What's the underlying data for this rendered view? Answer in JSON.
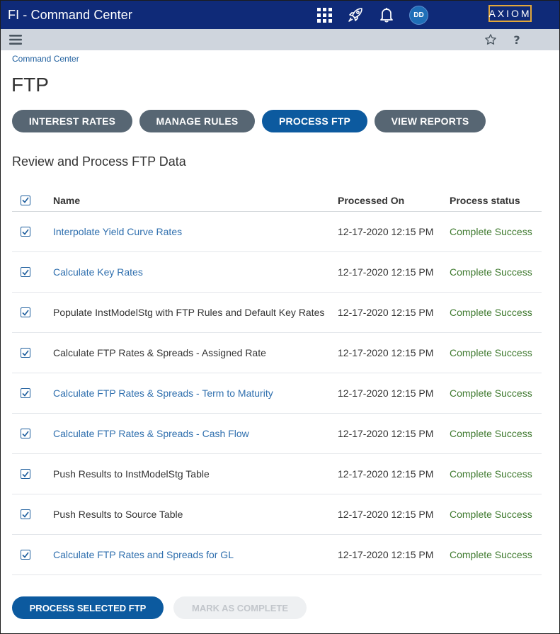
{
  "header": {
    "app_title": "FI - Command Center",
    "avatar_initials": "DD",
    "logo_text": "AXIOM",
    "icons": [
      "apps-grid-icon",
      "rocket-icon",
      "bell-icon"
    ]
  },
  "subbar": {
    "icons": [
      "menu-icon",
      "star-icon",
      "help-icon"
    ]
  },
  "breadcrumb": "Command Center",
  "page_title": "FTP",
  "nav_buttons": [
    "INTEREST RATES",
    "MANAGE RULES",
    "PROCESS FTP",
    "VIEW REPORTS"
  ],
  "active_nav": "PROCESS FTP",
  "section_title": "Review and Process FTP Data",
  "table": {
    "headers": {
      "name": "Name",
      "processed_on": "Processed On",
      "status": "Process status"
    },
    "rows": [
      {
        "name": "Interpolate Yield Curve Rates",
        "date": "12-17-2020 12:15 PM",
        "status": "Complete Success",
        "link": true
      },
      {
        "name": "Calculate Key Rates",
        "date": "12-17-2020 12:15 PM",
        "status": "Complete Success",
        "link": true
      },
      {
        "name": "Populate InstModelStg with FTP Rules and Default Key Rates",
        "date": "12-17-2020 12:15 PM",
        "status": "Complete Success",
        "link": false
      },
      {
        "name": "Calculate FTP Rates & Spreads - Assigned Rate",
        "date": "12-17-2020 12:15 PM",
        "status": "Complete Success",
        "link": false
      },
      {
        "name": "Calculate FTP Rates & Spreads - Term to Maturity",
        "date": "12-17-2020 12:15 PM",
        "status": "Complete Success",
        "link": true
      },
      {
        "name": "Calculate FTP Rates & Spreads - Cash Flow",
        "date": "12-17-2020 12:15 PM",
        "status": "Complete Success",
        "link": true
      },
      {
        "name": "Push Results to InstModelStg Table",
        "date": "12-17-2020 12:15 PM",
        "status": "Complete Success",
        "link": false
      },
      {
        "name": "Push Results to Source Table",
        "date": "12-17-2020 12:15 PM",
        "status": "Complete Success",
        "link": false
      },
      {
        "name": "Calculate FTP Rates and Spreads for GL",
        "date": "12-17-2020 12:15 PM",
        "status": "Complete Success",
        "link": true
      }
    ]
  },
  "footer": {
    "process_button": "PROCESS SELECTED FTP",
    "complete_button": "MARK AS COMPLETE"
  },
  "colors": {
    "topbar": "#0f2a78",
    "accent": "#0c5a9f",
    "pill": "#576673",
    "link": "#2f6fae",
    "success": "#3f7a2f",
    "logo_border": "#e3a73a"
  }
}
